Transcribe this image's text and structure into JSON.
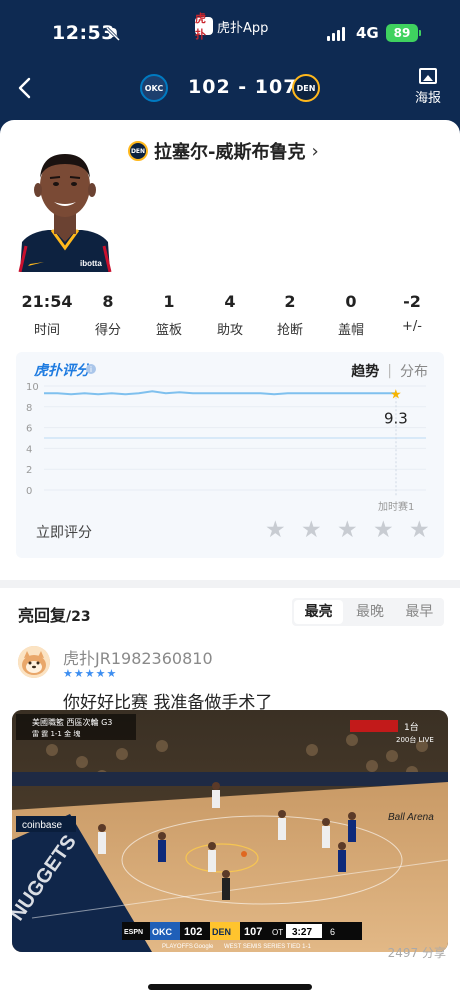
{
  "status_bar": {
    "time": "12:53",
    "app_name": "虎扑App",
    "app_logo_text": "虎扑",
    "network": "4G",
    "battery": "89"
  },
  "nav": {
    "home_team": "OKC",
    "away_team": "DEN",
    "score": "102 - 107",
    "poster_label": "海报"
  },
  "player": {
    "name": "拉塞尔-威斯布鲁克",
    "jersey_sponsor": "ibotta",
    "team_badge": "DEN",
    "stats": [
      {
        "value": "21:54",
        "label": "时间"
      },
      {
        "value": "8",
        "label": "得分"
      },
      {
        "value": "1",
        "label": "篮板"
      },
      {
        "value": "4",
        "label": "助攻"
      },
      {
        "value": "2",
        "label": "抢断"
      },
      {
        "value": "0",
        "label": "盖帽"
      },
      {
        "value": "-2",
        "label": "+/-"
      }
    ]
  },
  "rating": {
    "brand": "虎扑评分",
    "tab_trend": "趋势",
    "tab_separator": "|",
    "tab_distribution": "分布",
    "rate_now": "立即评分",
    "stars_total": 5,
    "stars_selected": 0
  },
  "chart_data": {
    "type": "line",
    "y_ticks": [
      "0",
      "2",
      "4",
      "6",
      "8",
      "10"
    ],
    "ylim": [
      0,
      10
    ],
    "x_end_label": "加时赛1",
    "current_value": "9.3",
    "reference_line": 5,
    "series": [
      {
        "values": [
          9.3,
          9.3,
          9.2,
          9.3,
          9.2,
          9.3,
          9.2,
          9.3,
          9.5,
          9.3,
          9.4,
          9.3,
          9.3,
          9.3,
          9.3,
          9.3,
          9.3,
          9.2,
          9.3,
          9.3,
          9.3,
          9.3,
          9.3,
          9.3,
          9.3,
          9.3,
          9.3
        ]
      }
    ],
    "colors": {
      "line": "#7fc0ee",
      "reference": "#cfe4f7",
      "marker": "#f6b400"
    }
  },
  "replies": {
    "title": "亮回复",
    "count": "/23",
    "sort_options": [
      "最亮",
      "最晚",
      "最早"
    ],
    "active_sort": 0,
    "first": {
      "username": "虎扑JR1982360810",
      "stars": "★★★★★",
      "text": "你好好比赛 我准备做手术了"
    }
  },
  "video": {
    "top_left_caption": "美國職籃 西區次輪 G3",
    "top_left_sub": "雷 霆 1-1 金 塊",
    "channel": "200台 LIVE",
    "channel_num": "1台",
    "home_abbr": "OKC",
    "home_score": "102",
    "away_abbr": "DEN",
    "away_score": "107",
    "period": "OT",
    "clock": "3:27",
    "shot_clock": "6",
    "series_note": "WEST SEMIS   SERIES TIED 1-1",
    "network_logo": "ESPN",
    "playoffs_logo": "PLAYOFFS",
    "sponsor": "Google",
    "ad_text": "coinbase",
    "arena_text": "Ball Arena",
    "baseline_text": "NUGGETS"
  },
  "bottom_text": "2497 分享"
}
